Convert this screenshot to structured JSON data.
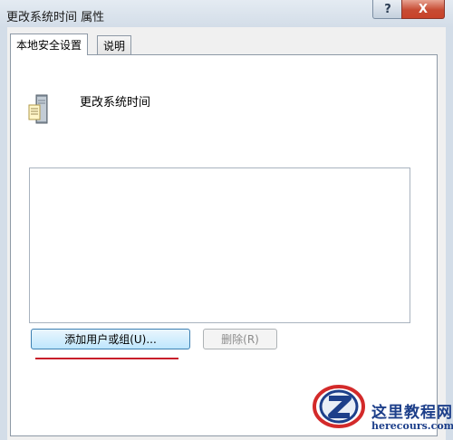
{
  "window": {
    "title": "更改系统时间 属性",
    "help_label": "?",
    "close_label": "X"
  },
  "tabs": [
    {
      "label": "本地安全设置",
      "active": true
    },
    {
      "label": "说明",
      "active": false
    }
  ],
  "policy": {
    "name": "更改系统时间",
    "icon": "server-policy-icon"
  },
  "members": [],
  "buttons": {
    "add_label": "添加用户或组(U)...",
    "remove_label": "删除(R)"
  },
  "watermark": {
    "name": "这里教程网",
    "url": "herecours.com"
  },
  "colors": {
    "highlight_underline": "#c81e2a",
    "close_button": "#c74b33"
  }
}
